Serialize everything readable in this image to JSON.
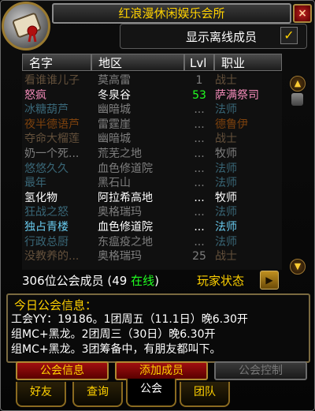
{
  "window": {
    "title": "红浪漫休闲娱乐会所",
    "close_glyph": "×"
  },
  "offline": {
    "label": "显示离线成员",
    "checkmark": "✓"
  },
  "columns": {
    "name": "名字",
    "zone": "地区",
    "level": "Lvl",
    "class": "职业"
  },
  "members": [
    {
      "name": "看谁谁儿子",
      "zone": "莫高雷",
      "level": "1",
      "class": "战士",
      "online": false,
      "name_color": "#c79c6e",
      "class_color": "#c79c6e"
    },
    {
      "name": "怒疯",
      "zone": "冬泉谷",
      "level": "53",
      "class": "萨满祭司",
      "online": true,
      "name_color": "#f58cba",
      "class_color": "#f58cba"
    },
    {
      "name": "冰糖葫芦",
      "zone": "幽暗城",
      "level": "...",
      "class": "法师",
      "online": false,
      "name_color": "#69ccf0",
      "class_color": "#69ccf0"
    },
    {
      "name": "夜半德语芦",
      "zone": "雷霆崖",
      "level": "...",
      "class": "德鲁伊",
      "online": false,
      "name_color": "#ff7d0a",
      "class_color": "#ff7d0a"
    },
    {
      "name": "夺命大榴莲",
      "zone": "幽暗城",
      "level": "...",
      "class": "战士",
      "online": false,
      "name_color": "#c79c6e",
      "class_color": "#c79c6e"
    },
    {
      "name": "奶一个死...",
      "zone": "荒芜之地",
      "level": "...",
      "class": "牧师",
      "online": false,
      "name_color": "#ffffff",
      "class_color": "#ffffff"
    },
    {
      "name": "悠悠久久",
      "zone": "血色修道院",
      "level": "...",
      "class": "法师",
      "online": false,
      "name_color": "#69ccf0",
      "class_color": "#69ccf0"
    },
    {
      "name": "最年",
      "zone": "黑石山",
      "level": "...",
      "class": "法师",
      "online": false,
      "name_color": "#69ccf0",
      "class_color": "#69ccf0"
    },
    {
      "name": "氢化物",
      "zone": "阿拉希高地",
      "level": "...",
      "class": "牧师",
      "online": true,
      "name_color": "#ffffff",
      "class_color": "#ffffff"
    },
    {
      "name": "狂战之怒",
      "zone": "奥格瑞玛",
      "level": "...",
      "class": "法师",
      "online": false,
      "name_color": "#69ccf0",
      "class_color": "#69ccf0"
    },
    {
      "name": "独占青楼",
      "zone": "血色修道院",
      "level": "...",
      "class": "法师",
      "online": true,
      "name_color": "#69ccf0",
      "class_color": "#69ccf0"
    },
    {
      "name": "行政总厨",
      "zone": "东瘟疫之地",
      "level": "...",
      "class": "法师",
      "online": false,
      "name_color": "#69ccf0",
      "class_color": "#69ccf0"
    },
    {
      "name": "没教养的...",
      "zone": "奥格瑞玛",
      "level": "25",
      "class": "战士",
      "online": false,
      "name_color": "#c79c6e",
      "class_color": "#c79c6e"
    }
  ],
  "footer": {
    "member_count": "306位公会成员 (49 ",
    "online_text": "在线",
    "close_paren": ")",
    "player_status": "玩家状态",
    "arrow": "▶"
  },
  "motd": {
    "title": "今日公会信息：",
    "lines": [
      "工会YY：19186。1团周五（11.1日）晚6.30开",
      "组MC+黑龙。2团周三（30日）晚6.30开",
      "组MC+黑龙。3团筹备中，有朋友都叫下。"
    ]
  },
  "actions": {
    "guild_info": "公会信息",
    "add_member": "添加成员",
    "guild_control": "公会控制"
  },
  "tabs": {
    "friends": "好友",
    "who": "查询",
    "guild": "公会",
    "raid": "团队"
  },
  "colors": {
    "online_level": "#20ff20",
    "title_text": "#ffd100"
  }
}
